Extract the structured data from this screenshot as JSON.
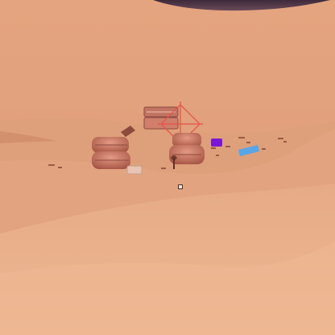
{
  "scene": {
    "kind": "first-person desert view",
    "colors": {
      "sky_haze": "#e6a983",
      "dune_far": "#dfa07b",
      "dune_mid": "#e3a681",
      "dune_near": "#eab08c",
      "sky_rock": "#5a3f4f",
      "barrel": "#c8735f",
      "barrel_shadow": "#8f4a3e",
      "marker_red": "#e8524a",
      "purple_item": "#7a17d6",
      "blue_item": "#5aa5e6",
      "crosshair_fill": "#f4e6dc"
    },
    "objects": [
      {
        "name": "distant-rock-formation",
        "icon": "rock"
      },
      {
        "name": "barrel-stack-left",
        "icon": "barrel"
      },
      {
        "name": "floating-crate",
        "icon": "crate"
      },
      {
        "name": "barrel-stack-center",
        "icon": "barrel"
      },
      {
        "name": "objective-marker",
        "icon": "diamond-marker"
      },
      {
        "name": "purple-loot-item",
        "icon": "loot-box"
      },
      {
        "name": "blue-loot-item",
        "icon": "loot-box"
      },
      {
        "name": "small-supply-box",
        "icon": "box"
      },
      {
        "name": "scattered-debris",
        "icon": "debris"
      }
    ]
  },
  "hud": {
    "crosshair": "center-square"
  }
}
